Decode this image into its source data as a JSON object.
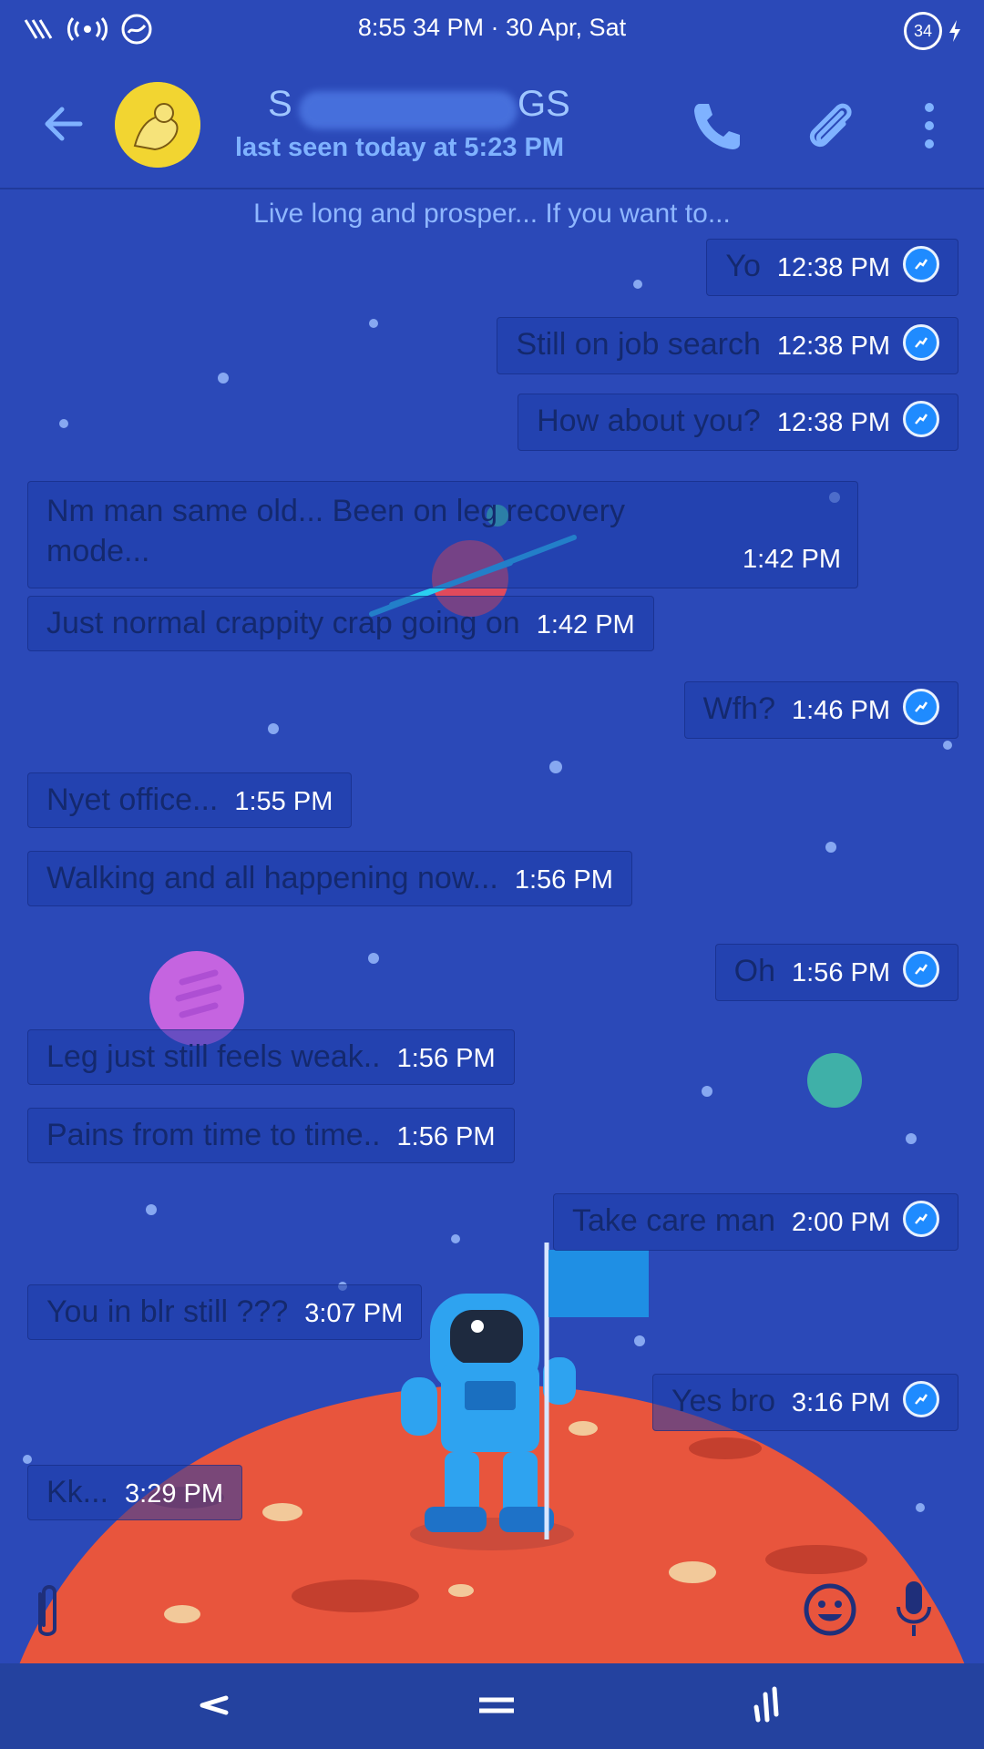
{
  "status_bar": {
    "time_date": "8:55 34 PM · 30 Apr, Sat",
    "battery": "34"
  },
  "header": {
    "name_start": "S",
    "name_end": "GS",
    "last_seen": "last seen today at 5:23 PM"
  },
  "subtitle": "Live long and prosper... If you want to...",
  "messages": [
    {
      "dir": "out",
      "text": "Yo",
      "time": "12:38 PM"
    },
    {
      "dir": "out",
      "text": "Still on job search",
      "time": "12:38 PM"
    },
    {
      "dir": "out",
      "text": "How about you?",
      "time": "12:38 PM"
    },
    {
      "dir": "in",
      "text": "Nm man same old... Been on leg recovery mode...",
      "time": "1:42 PM"
    },
    {
      "dir": "in",
      "text": "Just normal crappity crap going on",
      "time": "1:42 PM"
    },
    {
      "dir": "out",
      "text": "Wfh?",
      "time": "1:46 PM"
    },
    {
      "dir": "in",
      "text": "Nyet office...",
      "time": "1:55 PM"
    },
    {
      "dir": "in",
      "text": "Walking and all happening now...",
      "time": "1:56 PM"
    },
    {
      "dir": "out",
      "text": "Oh",
      "time": "1:56 PM"
    },
    {
      "dir": "in",
      "text": "Leg just still feels weak..",
      "time": "1:56 PM"
    },
    {
      "dir": "in",
      "text": "Pains from time to time..",
      "time": "1:56 PM"
    },
    {
      "dir": "out",
      "text": "Take care man",
      "time": "2:00 PM"
    },
    {
      "dir": "in",
      "text": "You in blr still ???",
      "time": "3:07 PM"
    },
    {
      "dir": "out",
      "text": "Yes bro",
      "time": "3:16 PM"
    },
    {
      "dir": "in",
      "text": "Kk...",
      "time": "3:29 PM"
    }
  ],
  "colors": {
    "background": "#2b49b8",
    "planet_surface": "#e8553d",
    "tick_blue": "#1f8bff",
    "header_text": "#7fb2ff"
  },
  "icons": [
    "back-arrow-icon",
    "avatar-icon",
    "phone-icon",
    "paperclip-icon",
    "more-vert-icon",
    "attachment-icon",
    "emoji-icon",
    "mic-icon",
    "nav-back-icon",
    "nav-home-icon",
    "nav-recents-icon",
    "read-receipt-icon"
  ]
}
